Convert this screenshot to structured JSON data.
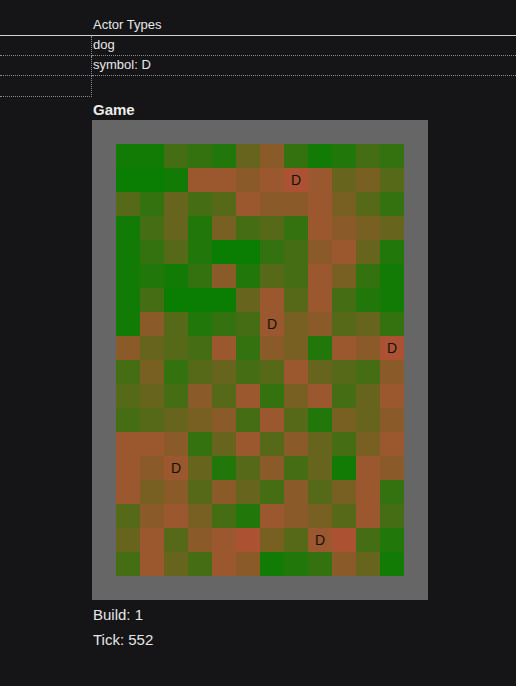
{
  "actor_types": {
    "title": "Actor Types",
    "types": [
      {
        "name": "dog",
        "symbol_label": "symbol: D"
      }
    ]
  },
  "game": {
    "title": "Game",
    "grid": [
      [
        0.1,
        0.1,
        0.4,
        0.3,
        0.2,
        0.6,
        0.8,
        0.3,
        0.1,
        0.2,
        0.4,
        0.3
      ],
      [
        0.05,
        0.05,
        0.1,
        0.9,
        0.9,
        0.8,
        0.9,
        1,
        0.9,
        0.6,
        0.7,
        0.5
      ],
      [
        0.5,
        0.3,
        0.6,
        0.4,
        0.5,
        0.9,
        0.8,
        0.8,
        0.9,
        0.7,
        0.5,
        0.3
      ],
      [
        0.1,
        0.4,
        0.6,
        0.2,
        0.7,
        0.4,
        0.5,
        0.3,
        0.9,
        0.8,
        0.7,
        0.6
      ],
      [
        0.1,
        0.3,
        0.5,
        0.2,
        0.05,
        0.05,
        0.3,
        0.4,
        0.8,
        0.9,
        0.6,
        0.2
      ],
      [
        0.1,
        0.2,
        0.1,
        0.3,
        0.8,
        0.2,
        0.5,
        0.4,
        0.9,
        0.7,
        0.3,
        0.1
      ],
      [
        0.1,
        0.4,
        0.05,
        0.05,
        0.05,
        0.6,
        0.9,
        0.5,
        0.9,
        0.4,
        0.2,
        0.1
      ],
      [
        0.1,
        0.8,
        0.5,
        0.2,
        0.3,
        0.4,
        0.9,
        0.7,
        0.8,
        0.5,
        0.6,
        0.3
      ],
      [
        0.8,
        0.6,
        0.5,
        0.4,
        0.9,
        0.3,
        0.8,
        0.7,
        0.2,
        0.9,
        0.8,
        1
      ],
      [
        0.4,
        0.7,
        0.3,
        0.5,
        0.6,
        0.4,
        0.5,
        0.9,
        0.6,
        0.5,
        0.4,
        0.8
      ],
      [
        0.5,
        0.6,
        0.4,
        0.8,
        0.5,
        0.9,
        0.3,
        0.7,
        0.9,
        0.4,
        0.6,
        0.9
      ],
      [
        0.4,
        0.5,
        0.6,
        0.7,
        0.8,
        0.4,
        0.9,
        0.5,
        0.2,
        0.7,
        0.6,
        0.8
      ],
      [
        0.9,
        0.9,
        0.8,
        0.3,
        0.6,
        0.9,
        0.5,
        0.8,
        0.6,
        0.4,
        0.7,
        0.9
      ],
      [
        0.9,
        0.8,
        0.9,
        0.6,
        0.2,
        0.5,
        0.8,
        0.4,
        0.6,
        0.1,
        0.9,
        0.8
      ],
      [
        0.9,
        0.7,
        0.8,
        0.5,
        0.8,
        0.6,
        0.4,
        0.8,
        0.5,
        0.7,
        0.9,
        0.3
      ],
      [
        0.5,
        0.8,
        0.9,
        0.7,
        0.4,
        0.2,
        0.9,
        0.8,
        0.7,
        0.5,
        0.9,
        0.4
      ],
      [
        0.6,
        0.9,
        0.5,
        0.8,
        0.9,
        1,
        0.7,
        0.5,
        0.9,
        1,
        0.4,
        0.2
      ],
      [
        0.4,
        0.9,
        0.6,
        0.4,
        0.9,
        0.8,
        0.1,
        0.2,
        0.3,
        0.8,
        0.6,
        0.1
      ]
    ],
    "actors": [
      {
        "symbol": "D",
        "row": 1,
        "col": 7
      },
      {
        "symbol": "D",
        "row": 7,
        "col": 6
      },
      {
        "symbol": "D",
        "row": 8,
        "col": 11
      },
      {
        "symbol": "D",
        "row": 13,
        "col": 2
      },
      {
        "symbol": "D",
        "row": 16,
        "col": 8
      }
    ]
  },
  "status": [
    {
      "label": "Build: 1"
    },
    {
      "label": "Tick: 552"
    }
  ]
}
